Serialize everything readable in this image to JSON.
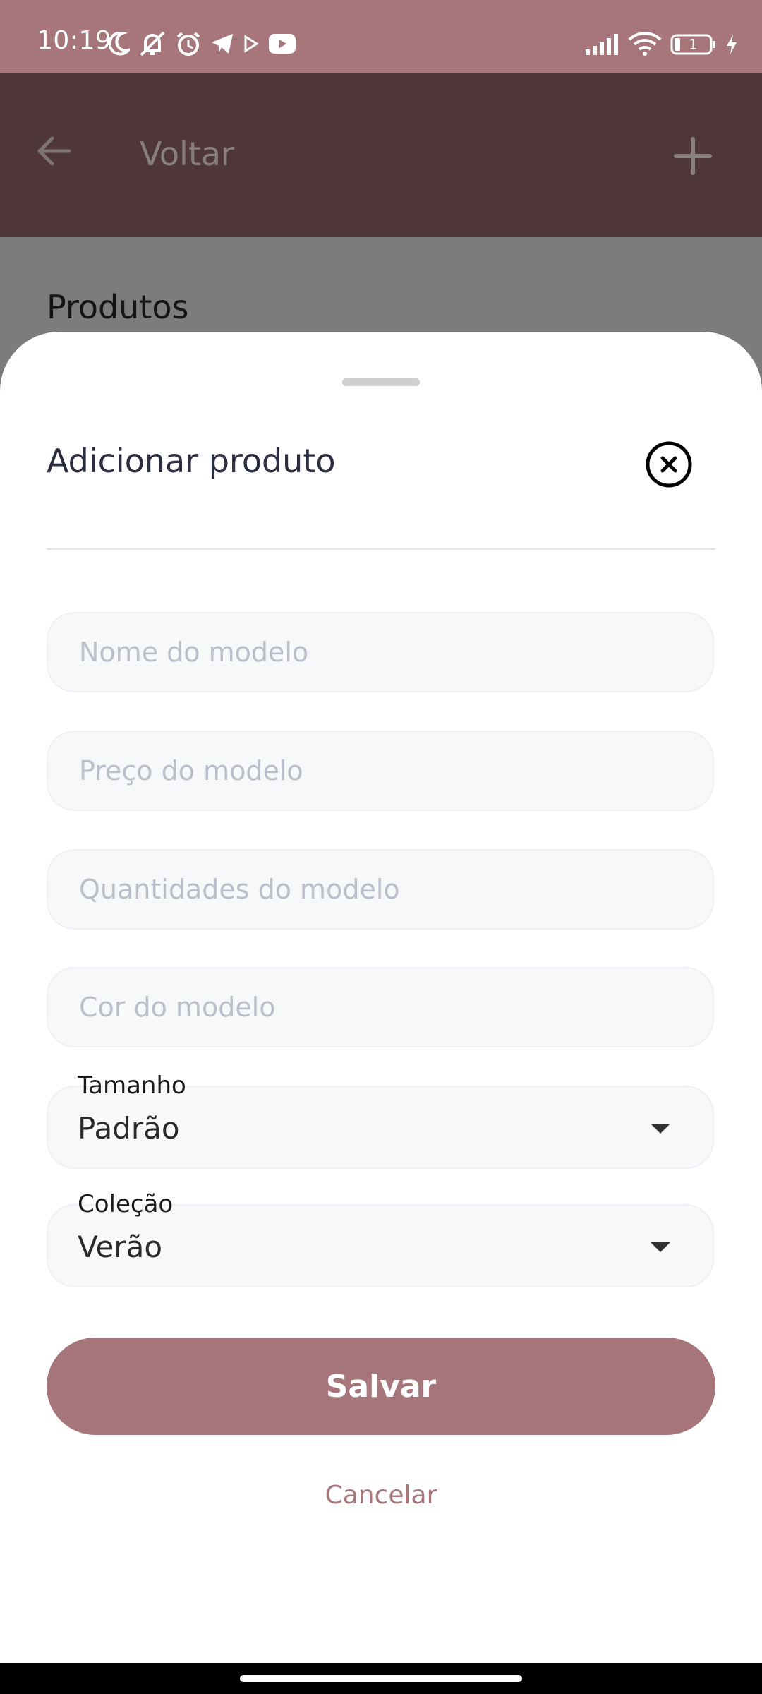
{
  "status_bar": {
    "time": "10:19",
    "battery": "1",
    "left_icons": [
      "moon-icon",
      "notifications-off-icon",
      "alarm-icon",
      "telegram-icon",
      "play-icon",
      "youtube-icon"
    ],
    "right_icons": [
      "signal-icon",
      "wifi-icon",
      "battery-icon",
      "charging-icon"
    ]
  },
  "app_bar": {
    "title": "Voltar",
    "back_icon": "arrow-left-icon",
    "add_icon": "plus-icon"
  },
  "page": {
    "heading": "Produtos"
  },
  "sheet": {
    "title": "Adicionar produto",
    "close_icon": "close-circle-icon",
    "fields": {
      "name_placeholder": "Nome do modelo",
      "price_placeholder": "Preço do modelo",
      "quantity_placeholder": "Quantidades do modelo",
      "color_placeholder": "Cor do modelo"
    },
    "size": {
      "label": "Tamanho",
      "value": "Padrão"
    },
    "collection": {
      "label": "Coleção",
      "value": "Verão"
    },
    "save_label": "Salvar",
    "cancel_label": "Cancelar"
  },
  "colors": {
    "accent": "#a6767a",
    "app_bar": "#4e363a",
    "scrim": "#7c7c7c"
  }
}
